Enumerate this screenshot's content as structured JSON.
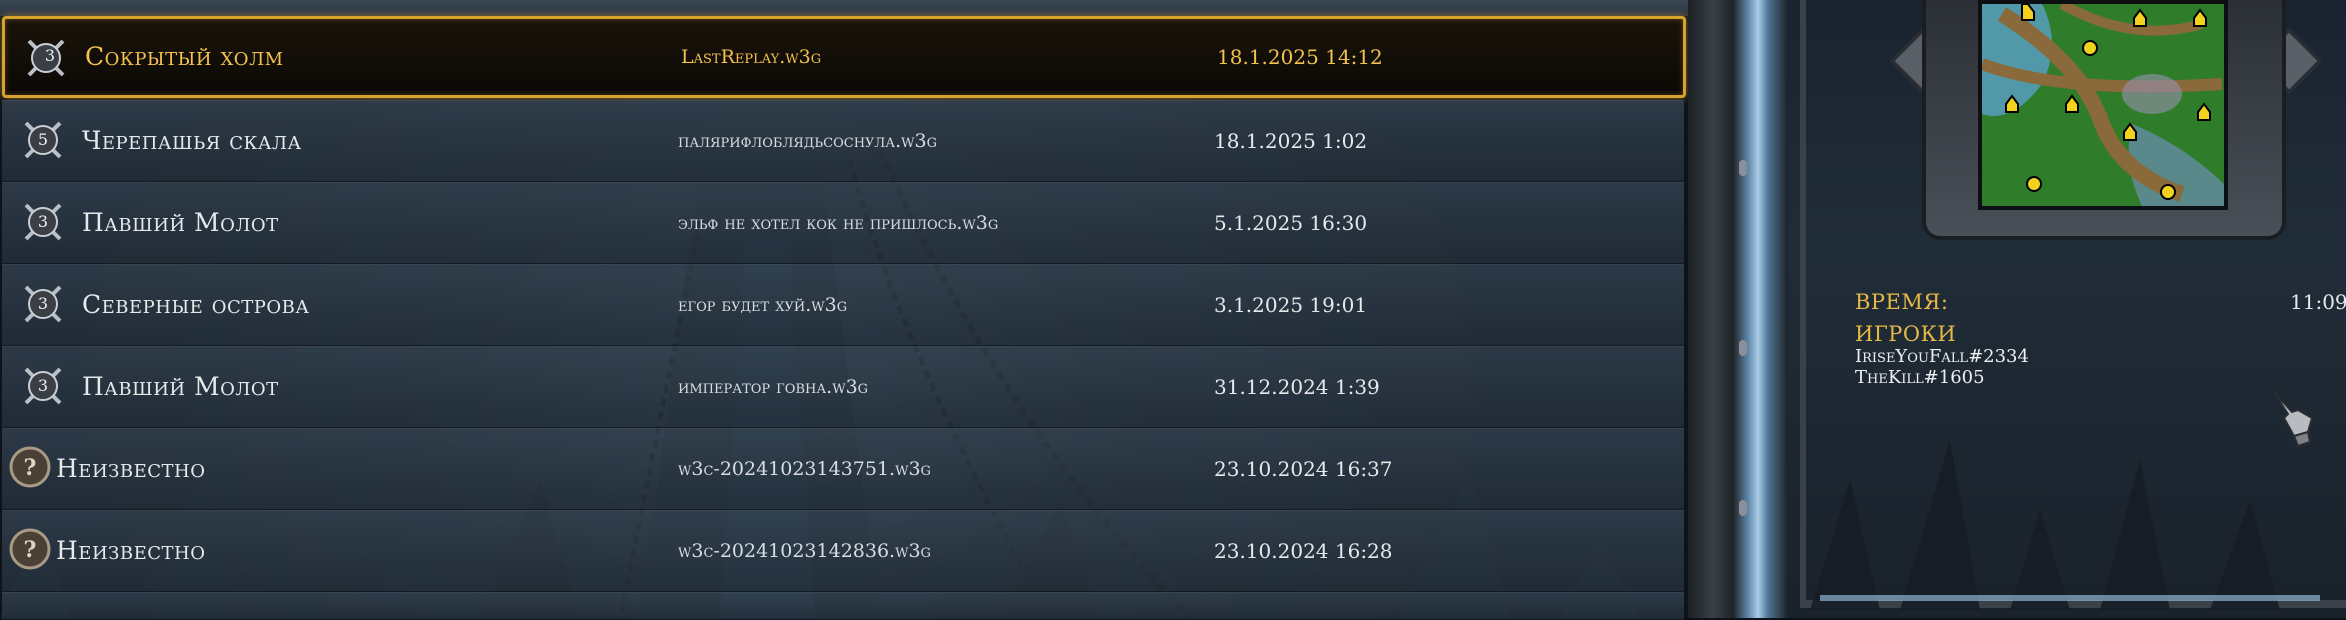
{
  "replays": [
    {
      "players": "3",
      "map": "Сокрытый холм",
      "file": "LastReplay.w3g",
      "date": "18.1.2025 14:12",
      "selected": true
    },
    {
      "players": "5",
      "map": "Черепашья скала",
      "file": "палярифлоблядьсоснула.w3g",
      "date": "18.1.2025 1:02"
    },
    {
      "players": "3",
      "map": "Павший Молот",
      "file": "эльф не хотел кок не пришлось.w3g",
      "date": "5.1.2025 16:30"
    },
    {
      "players": "3",
      "map": "Северные острова",
      "file": "егор будет хуй.w3g",
      "date": "3.1.2025 19:01"
    },
    {
      "players": "3",
      "map": "Павший Молот",
      "file": "император говна.w3g",
      "date": "31.12.2024 1:39"
    },
    {
      "players": "?",
      "map": "Неизвестно",
      "file": "w3c-20241023143751.w3g",
      "date": "23.10.2024 16:37"
    },
    {
      "players": "?",
      "map": "Неизвестно",
      "file": "w3c-20241023142836.w3g",
      "date": "23.10.2024 16:28"
    }
  ],
  "details": {
    "time_label": "ВРЕМЯ:",
    "time_value": "11:09",
    "players_label": "ИГРОКИ",
    "players": [
      "IriseYouFall#2334",
      "TheKill#1605"
    ]
  },
  "colors": {
    "accent_gold": "#e6b946",
    "selection_border": "#d8a22e"
  }
}
